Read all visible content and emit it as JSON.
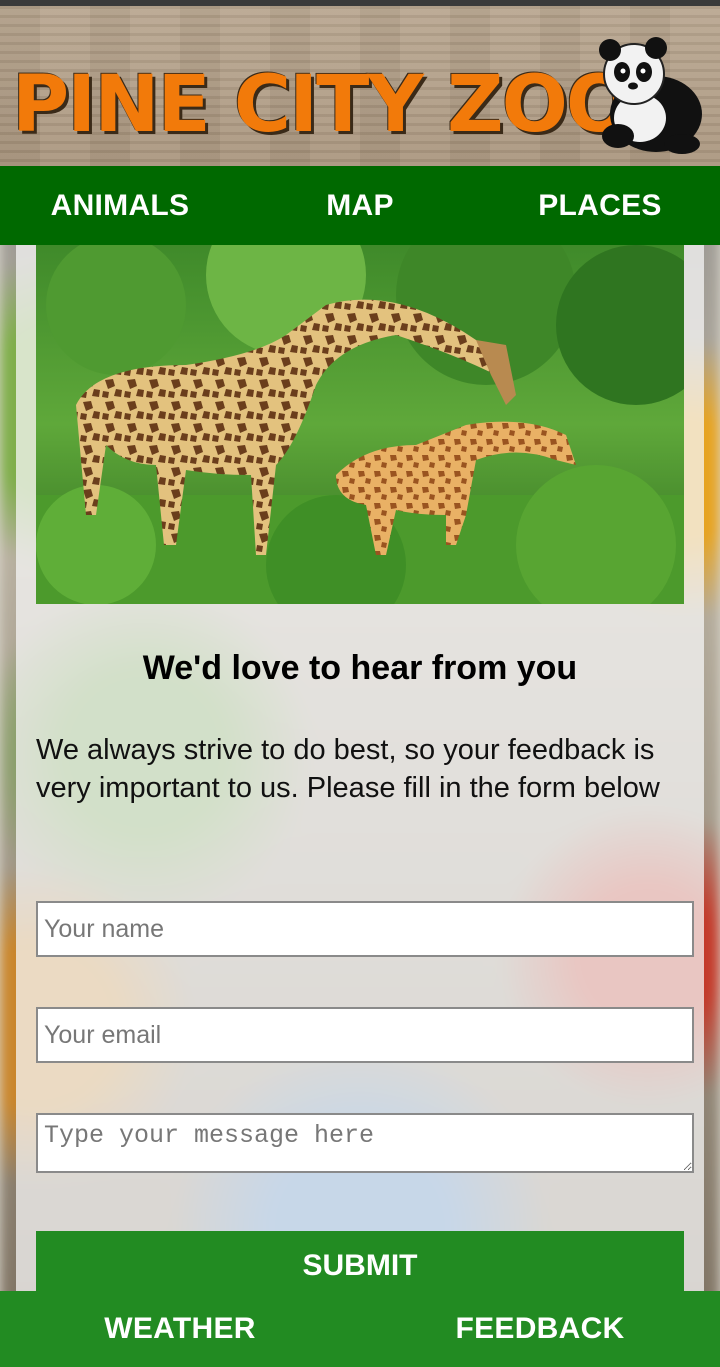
{
  "header": {
    "logo_text": "PINE CITY ZOO"
  },
  "top_nav": {
    "items": [
      "ANIMALS",
      "MAP",
      "PLACES"
    ]
  },
  "hero": {
    "image_alt": "Two giraffes in green bushes"
  },
  "feedback": {
    "heading": "We'd love to hear from you",
    "intro": "We always strive to do best, so your feedback is very important to us. Please fill in the form below",
    "name_placeholder": "Your name",
    "email_placeholder": "Your email",
    "message_placeholder": "Type your message here",
    "submit_label": "SUBMIT"
  },
  "bottom_nav": {
    "items": [
      "WEATHER",
      "FEEDBACK"
    ]
  },
  "colors": {
    "nav_dark_green": "#006900",
    "nav_green": "#228b22",
    "logo_orange": "#f27a0a"
  }
}
